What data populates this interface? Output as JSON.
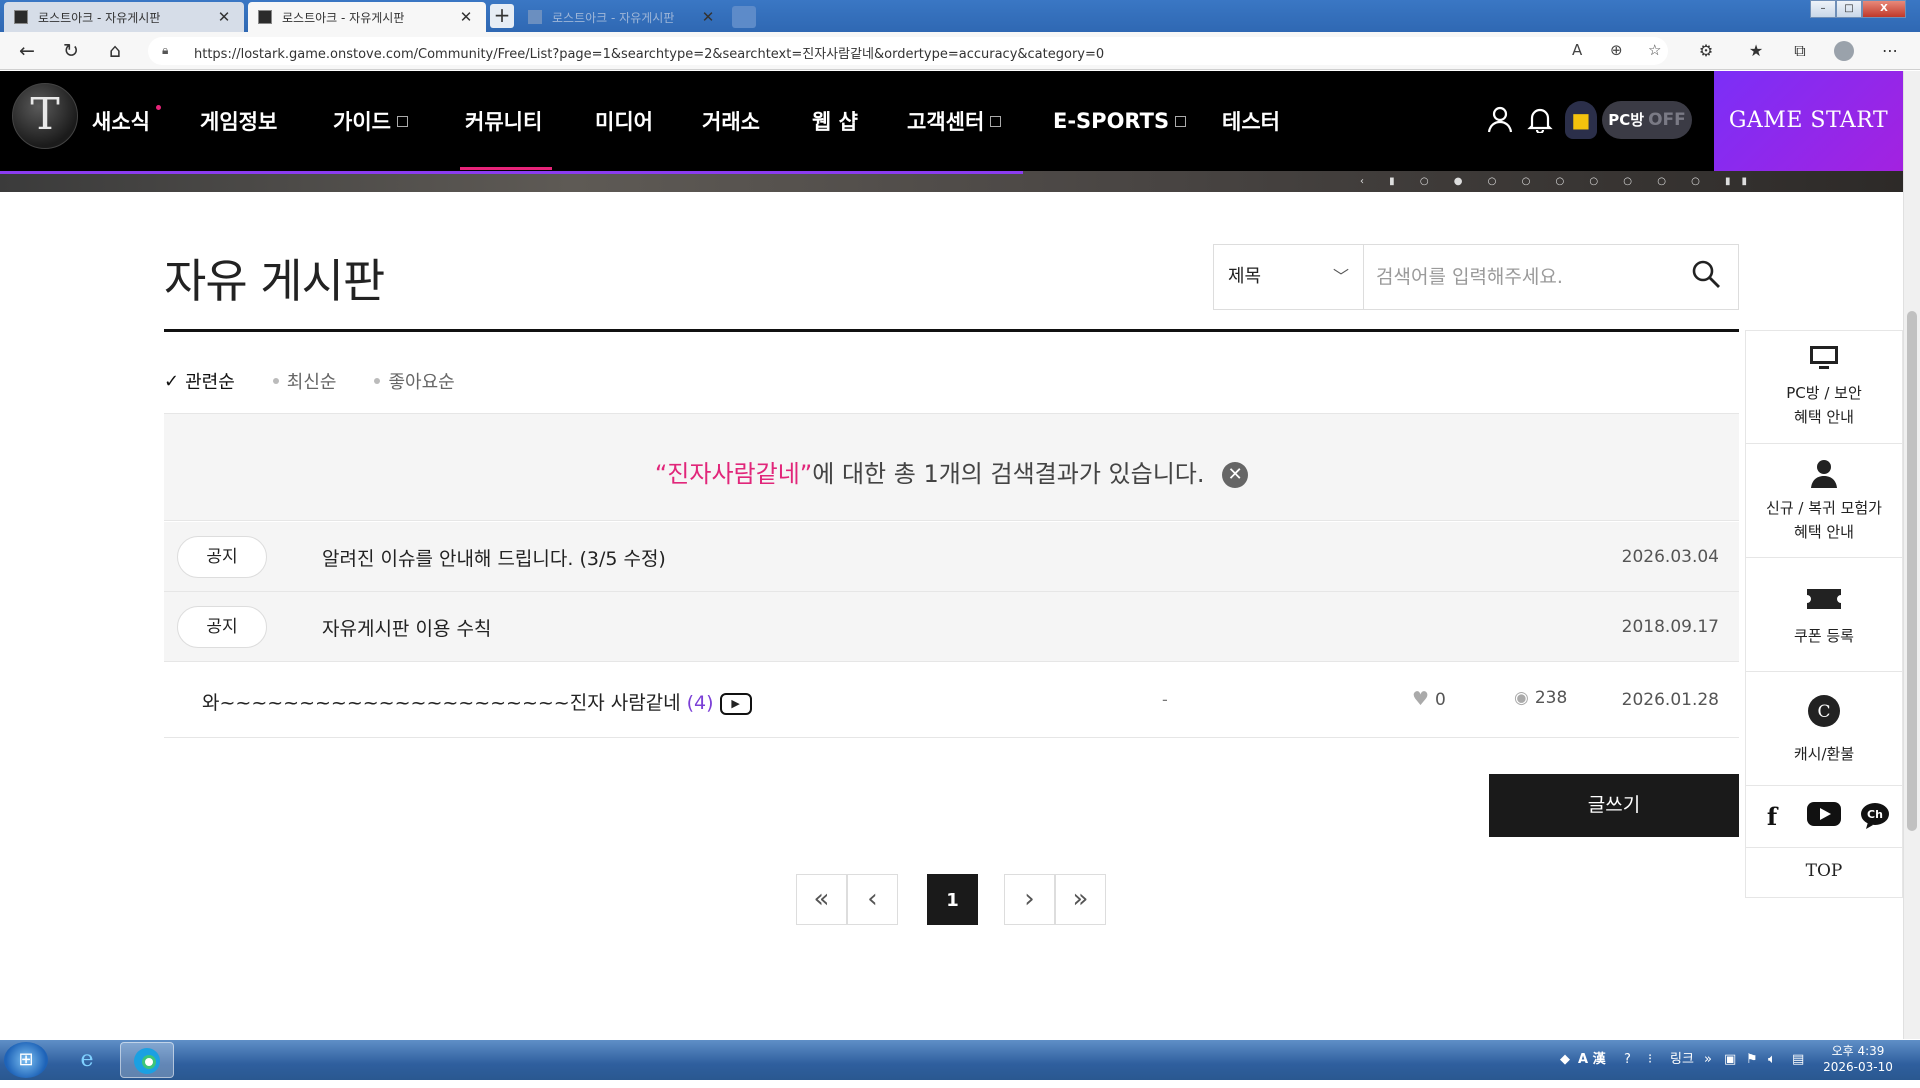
{
  "browser": {
    "tabs": [
      {
        "title": "로스트아크 - 자유게시판",
        "state": "inactive"
      },
      {
        "title": "로스트아크 - 자유게시판",
        "state": "active"
      },
      {
        "title": "로스트아크 - 자유게시판",
        "state": "faded"
      }
    ],
    "url": "https://lostark.game.onstove.com/Community/Free/List?page=1&searchtype=2&searchtext=진자사람같네&ordertype=accuracy&category=0",
    "window_controls": {
      "minimize": "–",
      "maximize": "□",
      "close": "X"
    }
  },
  "header": {
    "logo_glyph": "T",
    "menu": [
      {
        "label": "새소식",
        "new_dot": true,
        "external": false
      },
      {
        "label": "게임정보",
        "external": false
      },
      {
        "label": "가이드",
        "external": true
      },
      {
        "label": "커뮤니티",
        "external": false,
        "active": true
      },
      {
        "label": "미디어",
        "external": false
      },
      {
        "label": "거래소",
        "external": false
      },
      {
        "label": "웹 샵",
        "external": false
      },
      {
        "label": "고객센터",
        "external": true
      },
      {
        "label": "E-SPORTS",
        "external": true
      },
      {
        "label": "테스터",
        "external": false
      }
    ],
    "pcbang_label": "PC방",
    "pcbang_state": "OFF",
    "game_start": "GAME START",
    "accent_color": "#e8247a",
    "brand_purple": "#8b3cf0"
  },
  "board": {
    "title": "자유 게시판",
    "search": {
      "type_selected": "제목",
      "placeholder": "검색어를 입력해주세요."
    },
    "sorts": [
      {
        "label": "관련순",
        "selected": true
      },
      {
        "label": "최신순",
        "selected": false
      },
      {
        "label": "좋아요순",
        "selected": false
      }
    ],
    "result": {
      "keyword": "“진자사람같네”",
      "message": "에 대한 총 1개의 검색결과가 있습니다."
    },
    "notices": [
      {
        "badge": "공지",
        "title": "알려진 이슈를 안내해 드립니다. (3/5 수정)",
        "date": "2026.03.04"
      },
      {
        "badge": "공지",
        "title": "자유게시판 이용 수칙",
        "date": "2018.09.17"
      }
    ],
    "posts": [
      {
        "title": "와~~~~~~~~~~~~~~~~~~~~~~진자 사람같네",
        "comments": "(4)",
        "has_video": true,
        "author": "-",
        "likes": "0",
        "views": "238",
        "date": "2026.01.28"
      }
    ],
    "write_label": "글쓰기",
    "pagination": {
      "current": "1"
    }
  },
  "quick_menu": {
    "items": [
      {
        "label_lines": [
          "PC방 / 보안",
          "혜택 안내"
        ]
      },
      {
        "label_lines": [
          "신규 / 복귀 모험가",
          "혜택 안내"
        ]
      },
      {
        "label_lines": [
          "쿠폰 등록"
        ]
      },
      {
        "label_lines": [
          "캐시/환불"
        ]
      }
    ],
    "top_label": "TOP"
  },
  "taskbar": {
    "tray_text": "링크",
    "ime": "A 漢",
    "time": "오후 4:39",
    "date": "2026-03-10"
  }
}
